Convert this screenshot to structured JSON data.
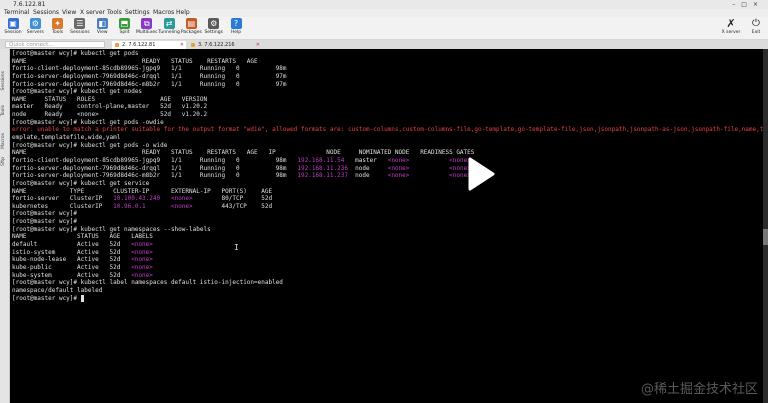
{
  "window": {
    "title": "7.6.122.81"
  },
  "menu": [
    "Terminal",
    "Sessions",
    "View",
    "X server",
    "Tools",
    "Settings",
    "Macros",
    "Help"
  ],
  "toolbar": [
    {
      "label": "Session",
      "icon": "session-icon",
      "color": "#2f6fd6"
    },
    {
      "label": "Servers",
      "icon": "servers-icon",
      "color": "#3f8fd8"
    },
    {
      "label": "Tools",
      "icon": "tools-icon",
      "color": "#d87a2a"
    },
    {
      "label": "Sessions",
      "icon": "sessions-icon",
      "color": "#6a6a6a"
    },
    {
      "label": "View",
      "icon": "view-icon",
      "color": "#4a7fbf"
    },
    {
      "label": "Split",
      "icon": "split-icon",
      "color": "#3a9a3a"
    },
    {
      "label": "MultiExec",
      "icon": "multiexec-icon",
      "color": "#8a3ac2"
    },
    {
      "label": "Tunneling",
      "icon": "tunneling-icon",
      "color": "#2a9a9a"
    },
    {
      "label": "Packages",
      "icon": "packages-icon",
      "color": "#c25a2a"
    },
    {
      "label": "Settings",
      "icon": "settings-icon",
      "color": "#5a5a5a"
    },
    {
      "label": "Help",
      "icon": "help-icon",
      "color": "#2a7ad6"
    }
  ],
  "xserver_label": "X server",
  "exit_label": "Exit",
  "quick_connect": "Quick connect...",
  "tabs": [
    {
      "label": "2. 7.6.122.81",
      "active": true
    },
    {
      "label": "3. 7.6.122.216",
      "active": false
    }
  ],
  "sidebar": [
    "Sessions",
    "Tools",
    "Macros",
    "Sftp"
  ],
  "terminal_lines": [
    [
      {
        "t": "[root@master wcy]# kubectl get pods"
      }
    ],
    [
      {
        "t": "NAME                                READY   STATUS    RESTARTS   AGE"
      }
    ],
    [
      {
        "t": "fortio-client-deployment-85cdb89965-jgpq9   1/1     Running   0          98m"
      }
    ],
    [
      {
        "t": "fortio-server-deployment-7969d8d46c-drqql   1/1     Running   0          97m"
      }
    ],
    [
      {
        "t": "fortio-server-deployment-7969d8d46c-m8b2r   1/1     Running   0          97m"
      }
    ],
    [
      {
        "t": "[root@master wcy]# kubectl get nodes"
      }
    ],
    [
      {
        "t": "NAME     STATUS   ROLES                  AGE   VERSION"
      }
    ],
    [
      {
        "t": "master   Ready    control-plane,master   52d   v1.20.2"
      }
    ],
    [
      {
        "t": "node     Ready    <none>                 52d   v1.20.2"
      }
    ],
    [
      {
        "t": "[root@master wcy]# kubectl get pods -owdie"
      }
    ],
    [
      {
        "t": "error: unable to match a printer suitable for the output format \"wdie\", allowed formats are: custom-columns,custom-columns-file,go-template,go-template-file,json,jsonpath,jsonpath-as-json,jsonpath-file,name,t",
        "c": "err"
      }
    ],
    [
      {
        "t": "emplate,templatefile,wide,yaml"
      }
    ],
    [
      {
        "t": "[root@master wcy]# kubectl get pods -o wide"
      }
    ],
    [
      {
        "t": "NAME                                READY   STATUS    RESTARTS   AGE   IP              NODE     NOMINATED NODE   READINESS GATES"
      }
    ],
    [
      {
        "t": "fortio-client-deployment-85cdb89965-jgpq9   1/1     Running   0          98m   "
      },
      {
        "t": "192.168.11.54",
        "c": "ip"
      },
      {
        "t": "   master   "
      },
      {
        "t": "<none>",
        "c": "none"
      },
      {
        "t": "           "
      },
      {
        "t": "<none>",
        "c": "none"
      }
    ],
    [
      {
        "t": "fortio-server-deployment-7969d8d46c-drqql   1/1     Running   0          98m   "
      },
      {
        "t": "192.168.11.236",
        "c": "ip"
      },
      {
        "t": "  node     "
      },
      {
        "t": "<none>",
        "c": "none"
      },
      {
        "t": "           "
      },
      {
        "t": "<none>",
        "c": "none"
      }
    ],
    [
      {
        "t": "fortio-server-deployment-7969d8d46c-m8b2r   1/1     Running   0          98m   "
      },
      {
        "t": "192.168.11.237",
        "c": "ip"
      },
      {
        "t": "  node     "
      },
      {
        "t": "<none>",
        "c": "none"
      },
      {
        "t": "           "
      },
      {
        "t": "<none>",
        "c": "none"
      }
    ],
    [
      {
        "t": "[root@master wcy]# kubectl get service"
      }
    ],
    [
      {
        "t": "NAME            TYPE        CLUSTER-IP      EXTERNAL-IP   PORT(S)    AGE"
      }
    ],
    [
      {
        "t": "fortio-server   ClusterIP   "
      },
      {
        "t": "10.100.43.240",
        "c": "ip"
      },
      {
        "t": "   "
      },
      {
        "t": "<none>",
        "c": "none"
      },
      {
        "t": "        80/TCP     52d"
      }
    ],
    [
      {
        "t": "kubernetes      ClusterIP   "
      },
      {
        "t": "10.96.0.1",
        "c": "ip"
      },
      {
        "t": "       "
      },
      {
        "t": "<none>",
        "c": "none"
      },
      {
        "t": "        443/TCP    52d"
      }
    ],
    [
      {
        "t": "[root@master wcy]#"
      }
    ],
    [
      {
        "t": "[root@master wcy]#"
      }
    ],
    [
      {
        "t": "[root@master wcy]# kubectl get namespaces --show-labels"
      }
    ],
    [
      {
        "t": "NAME              STATUS   AGE   LABELS"
      }
    ],
    [
      {
        "t": "default           Active   52d   "
      },
      {
        "t": "<none>",
        "c": "none"
      }
    ],
    [
      {
        "t": "istio-system      Active   52d   "
      },
      {
        "t": "<none>",
        "c": "none"
      }
    ],
    [
      {
        "t": "kube-node-lease   Active   52d   "
      },
      {
        "t": "<none>",
        "c": "none"
      }
    ],
    [
      {
        "t": "kube-public       Active   52d   "
      },
      {
        "t": "<none>",
        "c": "none"
      }
    ],
    [
      {
        "t": "kube-system       Active   52d   "
      },
      {
        "t": "<none>",
        "c": "none"
      }
    ],
    [
      {
        "t": "[root@master wcy]# kubectl label namespaces default istio-injection=enabled"
      }
    ],
    [
      {
        "t": "namespace/default labeled"
      }
    ],
    [
      {
        "t": "[root@master wcy]# "
      },
      {
        "t": " ",
        "c": "cursor"
      }
    ]
  ],
  "colors": {
    "error": "#e34242",
    "ip": "#c23cc7",
    "none": "#c23cc7",
    "terminal_bg": "#000000",
    "terminal_fg": "#e0e0e0"
  },
  "watermark": "@稀土掘金技术社区"
}
